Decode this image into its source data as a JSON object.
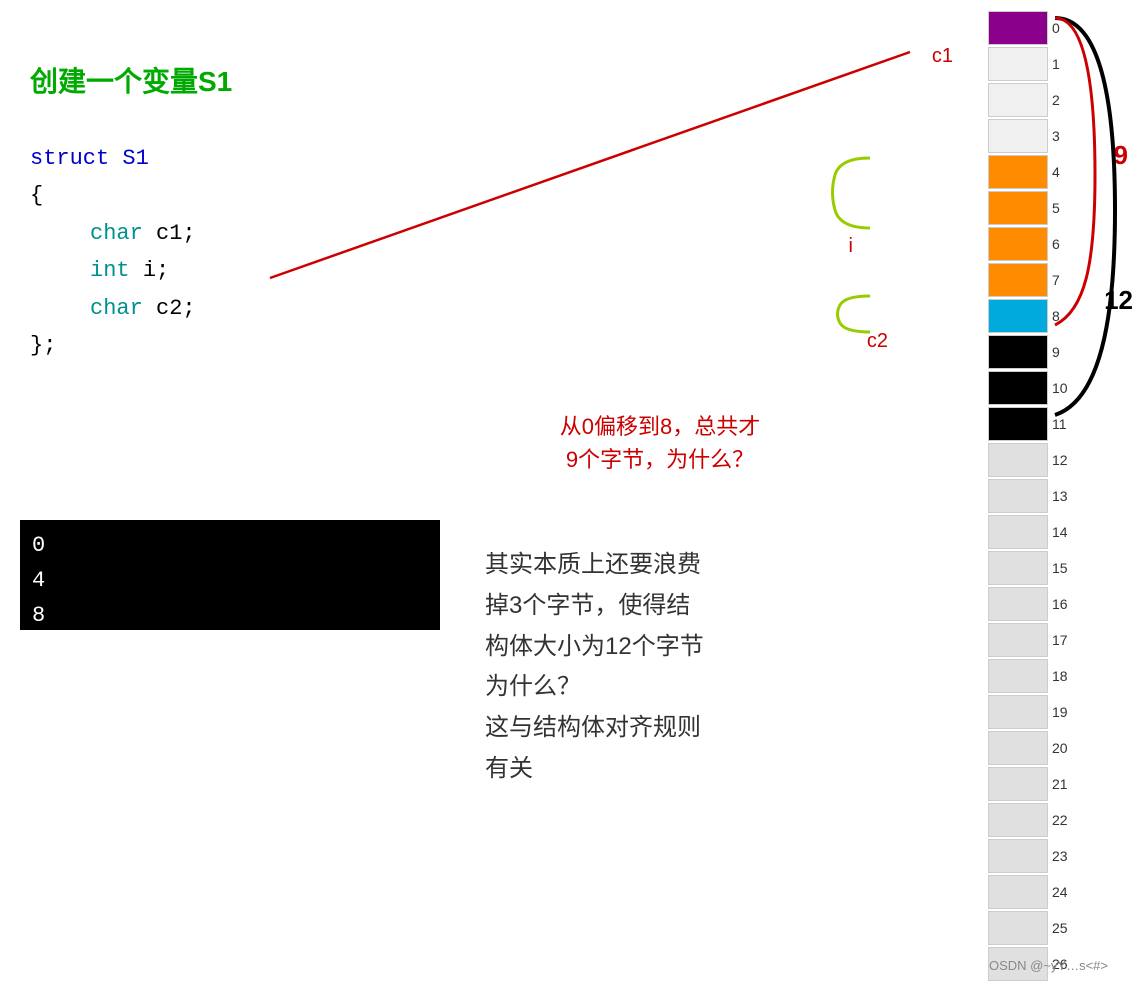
{
  "title": "创建一个变量S1",
  "code": {
    "line1": "struct S1",
    "line2": "{",
    "line3": "    char c1;",
    "line4": "    int i;",
    "line5": "    char c2;",
    "line6": "};"
  },
  "terminal": {
    "lines": [
      "0",
      "4",
      "8"
    ]
  },
  "labels": {
    "c1": "c1",
    "i": "i",
    "c2": "c2",
    "nine": "9",
    "twelve": "12"
  },
  "memory_rows": [
    {
      "index": 0,
      "color": "purple"
    },
    {
      "index": 1,
      "color": "white"
    },
    {
      "index": 2,
      "color": "white"
    },
    {
      "index": 3,
      "color": "white"
    },
    {
      "index": 4,
      "color": "orange"
    },
    {
      "index": 5,
      "color": "orange"
    },
    {
      "index": 6,
      "color": "orange"
    },
    {
      "index": 7,
      "color": "orange"
    },
    {
      "index": 8,
      "color": "cyan"
    },
    {
      "index": 9,
      "color": "black"
    },
    {
      "index": 10,
      "color": "black"
    },
    {
      "index": 11,
      "color": "black"
    },
    {
      "index": 12,
      "color": "lightgray"
    },
    {
      "index": 13,
      "color": "lightgray"
    },
    {
      "index": 14,
      "color": "lightgray"
    },
    {
      "index": 15,
      "color": "lightgray"
    },
    {
      "index": 16,
      "color": "lightgray"
    },
    {
      "index": 17,
      "color": "lightgray"
    },
    {
      "index": 18,
      "color": "lightgray"
    },
    {
      "index": 19,
      "color": "lightgray"
    },
    {
      "index": 20,
      "color": "lightgray"
    },
    {
      "index": 21,
      "color": "lightgray"
    },
    {
      "index": 22,
      "color": "lightgray"
    },
    {
      "index": 23,
      "color": "lightgray"
    },
    {
      "index": 24,
      "color": "lightgray"
    },
    {
      "index": 25,
      "color": "lightgray"
    },
    {
      "index": 26,
      "color": "lightgray"
    }
  ],
  "annotations": {
    "question": "从0偏移到8，总共才\n9个字节，为什么？",
    "explanation_line1": "其实本质上还要浪费",
    "explanation_line2": "掉3个字节，使得结",
    "explanation_line3": "构体大小为12个字节",
    "explanation_line4": "为什么？",
    "explanation_line5": "这与结构体对齐规则",
    "explanation_line6": "有关"
  },
  "watermark": "OSDN @~yY…s<#>"
}
